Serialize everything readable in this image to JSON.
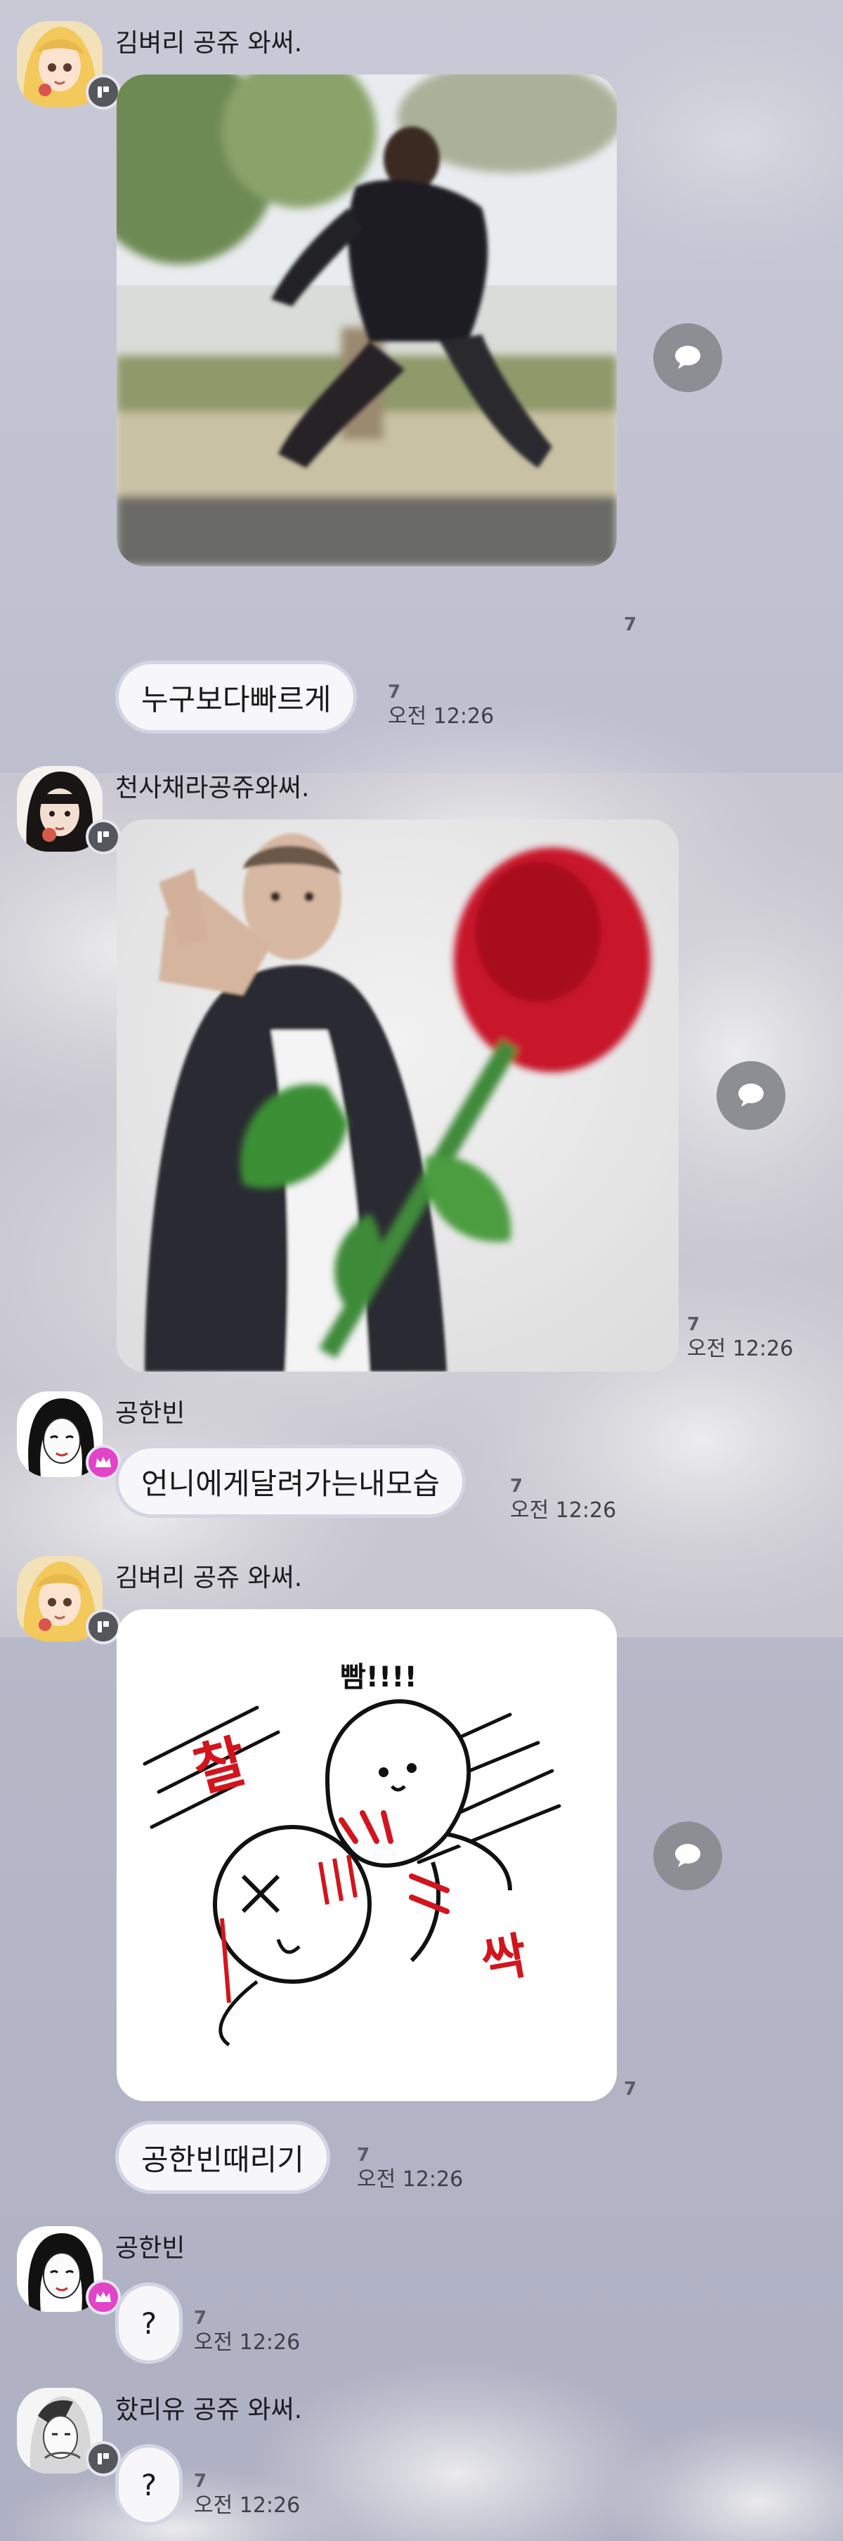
{
  "messages": [
    {
      "sender": "김벼리 공쥬 와써.",
      "unread": "7"
    },
    {
      "text": "누구보다빠르게",
      "unread": "7",
      "time": "오전 12:26"
    },
    {
      "sender": "천사채라공쥬와써.",
      "unread": "7",
      "time": "오전 12:26"
    },
    {
      "sender": "공한빈",
      "text": "언니에게달려가는내모습",
      "unread": "7",
      "time": "오전 12:26"
    },
    {
      "sender": "김벼리 공쥬 와써.",
      "unread": "7",
      "sticker_text": [
        "빰!!!!",
        "찰",
        "싹"
      ]
    },
    {
      "text": "공한빈때리기",
      "unread": "7",
      "time": "오전 12:26"
    },
    {
      "sender": "공한빈",
      "text": "?",
      "unread": "7",
      "time": "오전 12:26"
    },
    {
      "sender": "핬리유 공쥬 와써.",
      "text": "?",
      "unread": "7",
      "time": "오전 12:26"
    }
  ],
  "theme": {
    "bubble_border": "#d3d4e3",
    "share_button": "#8d8d94",
    "crown_badge": "#e243c9",
    "ghost_badge": "#55575c"
  },
  "icons": [
    "chat-bubble-icon",
    "ghost-icon",
    "crown-icon"
  ]
}
